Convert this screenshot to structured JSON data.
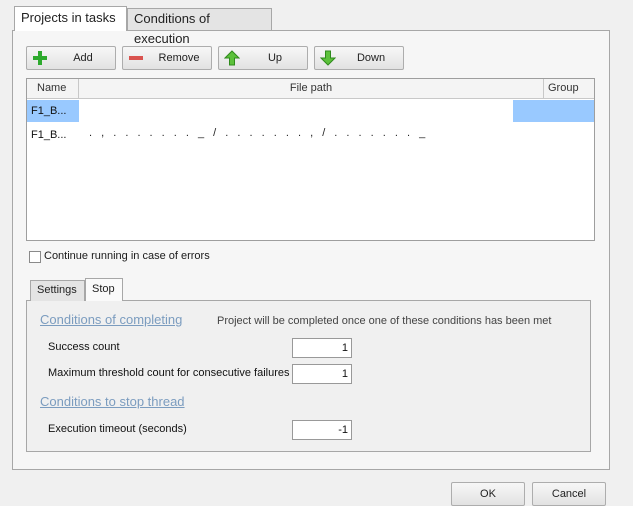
{
  "tabs": {
    "projects": "Projects in tasks",
    "conditions": "Conditions of execution"
  },
  "toolbar": {
    "add": "Add",
    "remove": "Remove",
    "up": "Up",
    "down": "Down"
  },
  "grid": {
    "columns": {
      "name": "Name",
      "path": "File path",
      "group": "Group"
    },
    "rows": [
      {
        "name": "F1_B...",
        "path": "",
        "group": ""
      },
      {
        "name": "F1_B...",
        "path": ". , . . . . . . . _ / . . . . . . . , / . . . . . . . _",
        "group": ""
      }
    ]
  },
  "continue_label": "Continue running in case of errors",
  "inner_tabs": {
    "settings": "Settings",
    "stop": "Stop"
  },
  "stop": {
    "completing_title": "Conditions of completing",
    "completing_note": "Project will be completed once one of these conditions has been met",
    "success_label": "Success count",
    "success_value": "1",
    "failures_label": "Maximum threshold count for consecutive failures",
    "failures_value": "1",
    "thread_title": "Conditions to stop thread",
    "timeout_label": "Execution timeout (seconds)",
    "timeout_value": "-1"
  },
  "buttons": {
    "ok": "OK",
    "cancel": "Cancel"
  },
  "colors": {
    "selection": "#99c9ff",
    "section": "#7b9cbf",
    "add_green": "#2eaa2e",
    "remove_red": "#d9534f"
  }
}
